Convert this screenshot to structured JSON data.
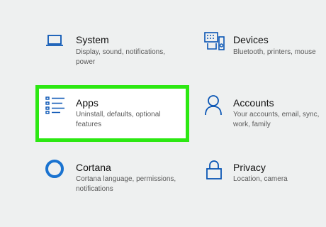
{
  "accent_color": "#0a56b5",
  "highlight_color": "#2ce812",
  "tiles": [
    {
      "id": "system",
      "title": "System",
      "desc": [
        "Display, sound, notifications,",
        "power"
      ],
      "icon": "laptop-icon"
    },
    {
      "id": "devices",
      "title": "Devices",
      "desc": [
        "Bluetooth, printers, mouse"
      ],
      "icon": "keyboard-speaker-icon"
    },
    {
      "id": "apps",
      "title": "Apps",
      "desc": [
        "Uninstall, defaults, optional",
        "features"
      ],
      "icon": "list-icon",
      "highlighted": true
    },
    {
      "id": "accounts",
      "title": "Accounts",
      "desc": [
        "Your accounts, email, sync,",
        "work, family"
      ],
      "icon": "person-icon"
    },
    {
      "id": "cortana",
      "title": "Cortana",
      "desc": [
        "Cortana language, permissions,",
        "notifications"
      ],
      "icon": "cortana-circle-icon"
    },
    {
      "id": "privacy",
      "title": "Privacy",
      "desc": [
        "Location, camera"
      ],
      "icon": "lock-icon"
    }
  ]
}
